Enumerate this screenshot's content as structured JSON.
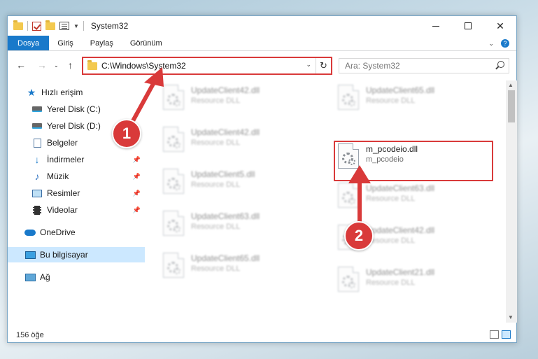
{
  "window": {
    "title": "System32"
  },
  "ribbon": {
    "tabs": [
      {
        "label": "Dosya"
      },
      {
        "label": "Giriş"
      },
      {
        "label": "Paylaş"
      },
      {
        "label": "Görünüm"
      }
    ]
  },
  "address": {
    "path": "C:\\Windows\\System32"
  },
  "search": {
    "placeholder": "Ara: System32"
  },
  "nav": {
    "items": [
      {
        "label": "Hızlı erişim",
        "icon": "star-icon"
      },
      {
        "label": "Yerel Disk (C:)",
        "icon": "drive-icon"
      },
      {
        "label": "Yerel Disk (D:)",
        "icon": "drive-icon"
      },
      {
        "label": "Belgeler",
        "icon": "documents-icon"
      },
      {
        "label": "İndirmeler",
        "icon": "download-icon"
      },
      {
        "label": "Müzik",
        "icon": "music-icon"
      },
      {
        "label": "Resimler",
        "icon": "pictures-icon"
      },
      {
        "label": "Videolar",
        "icon": "videos-icon"
      },
      {
        "label": "OneDrive",
        "icon": "cloud-icon"
      },
      {
        "label": "Bu bilgisayar",
        "icon": "computer-icon"
      },
      {
        "label": "Ağ",
        "icon": "network-icon"
      }
    ]
  },
  "files": {
    "left": [
      {
        "name": "UpdateClient42.dll",
        "type": "Resource DLL"
      },
      {
        "name": "UpdateClient42.dll",
        "type": "Resource DLL"
      },
      {
        "name": "UpdateClient5.dll",
        "type": "Resource DLL"
      },
      {
        "name": "UpdateClient63.dll",
        "type": "Resource DLL"
      },
      {
        "name": "UpdateClient65.dll",
        "type": "Resource DLL"
      }
    ],
    "right": [
      {
        "name": "UpdateClient65.dll",
        "type": "Resource DLL"
      },
      {
        "name": "UpdateClient63.dll",
        "type": "Resource DLL"
      },
      {
        "name": "UpdateClient42.dll",
        "type": "Resource DLL"
      },
      {
        "name": "UpdateClient21.dll",
        "type": "Resource DLL"
      }
    ],
    "target": {
      "name": "m_pcodeio.dll",
      "type": "m_pcodeio"
    }
  },
  "status": {
    "count": "156 öğe"
  },
  "callouts": {
    "one": "1",
    "two": "2"
  },
  "colors": {
    "accent": "#1979ca",
    "annotation": "#d93a3a"
  }
}
